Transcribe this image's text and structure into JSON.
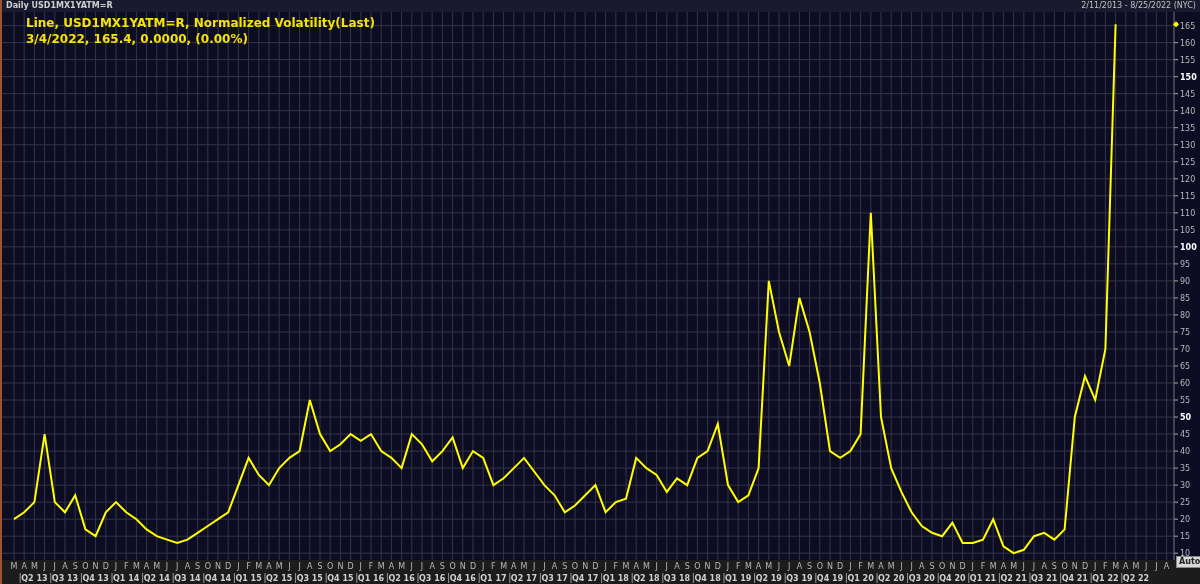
{
  "header": {
    "title": "Daily USD1MX1YATM=R",
    "date_range": "2/11/2013 - 8/25/2022 (NYC)"
  },
  "legend": {
    "chart_label": "Line,",
    "separator": ",",
    "field": "Normalized Volatility(Last)",
    "line_2": "3/4/2022, 165.4, 0.0000, (0.00%)"
  },
  "chart": {
    "chart_data": {
      "type": "line",
      "categories": [
        "M",
        "A",
        "M",
        "J",
        "J",
        "A",
        "S",
        "O",
        "N",
        "D",
        "J",
        "F",
        "M",
        "A",
        "M",
        "J",
        "J",
        "A",
        "S",
        "O",
        "N",
        "D",
        "J",
        "F",
        "M",
        "A",
        "M",
        "J",
        "J",
        "A",
        "S",
        "O",
        "N",
        "D",
        "J",
        "F",
        "M",
        "A",
        "M",
        "J",
        "J",
        "A",
        "S",
        "O",
        "N",
        "D",
        "J",
        "F",
        "M",
        "A",
        "M",
        "J",
        "J",
        "A",
        "S",
        "O",
        "N",
        "D",
        "J",
        "F",
        "M",
        "A",
        "M",
        "J",
        "J",
        "A",
        "S",
        "O",
        "N",
        "D",
        "J",
        "F",
        "M",
        "A",
        "M",
        "J",
        "J",
        "A",
        "S",
        "O",
        "N",
        "D",
        "J",
        "F",
        "M",
        "A",
        "M",
        "J",
        "J",
        "A",
        "S",
        "O",
        "N",
        "D",
        "J",
        "F",
        "M",
        "A",
        "M",
        "J",
        "J",
        "A",
        "S",
        "O",
        "N",
        "D",
        "J",
        "F",
        "M",
        "A",
        "M",
        "J",
        "J",
        "A"
      ],
      "series": [
        {
          "name": "USD1MX1YATM=R",
          "color": "#ffff00",
          "values": [
            20,
            22,
            25,
            45,
            25,
            22,
            27,
            17,
            15,
            22,
            25,
            22,
            20,
            17,
            15,
            14,
            13,
            14,
            16,
            18,
            20,
            22,
            30,
            38,
            33,
            30,
            35,
            38,
            40,
            55,
            45,
            40,
            42,
            45,
            43,
            45,
            40,
            38,
            35,
            45,
            42,
            37,
            40,
            44,
            35,
            40,
            38,
            30,
            32,
            35,
            38,
            34,
            30,
            27,
            22,
            24,
            27,
            30,
            22,
            25,
            26,
            38,
            35,
            33,
            28,
            32,
            30,
            38,
            40,
            48,
            30,
            25,
            27,
            35,
            90,
            75,
            65,
            85,
            75,
            60,
            40,
            38,
            40,
            45,
            110,
            50,
            35,
            28,
            22,
            18,
            16,
            15,
            19,
            13,
            13,
            14,
            20,
            12,
            10,
            11,
            15,
            16,
            14,
            17,
            50,
            62,
            55,
            70,
            165.4,
            null,
            null,
            null,
            null,
            null
          ]
        }
      ],
      "grid": true,
      "ylim": [
        8,
        169
      ],
      "yticks": [
        10,
        15,
        20,
        25,
        30,
        35,
        40,
        45,
        50,
        55,
        60,
        65,
        70,
        75,
        80,
        85,
        90,
        95,
        100,
        105,
        110,
        115,
        120,
        125,
        130,
        135,
        140,
        145,
        150,
        155,
        160,
        165
      ]
    },
    "quarter_labels": [
      "Q2 13",
      "Q3 13",
      "Q4 13",
      "Q1 14",
      "Q2 14",
      "Q3 14",
      "Q4 14",
      "Q1 15",
      "Q2 15",
      "Q3 15",
      "Q4 15",
      "Q1 16",
      "Q2 16",
      "Q3 16",
      "Q4 16",
      "Q1 17",
      "Q2 17",
      "Q3 17",
      "Q4 17",
      "Q1 18",
      "Q2 18",
      "Q3 18",
      "Q4 18",
      "Q1 19",
      "Q2 19",
      "Q3 19",
      "Q4 19",
      "Q1 20",
      "Q2 20",
      "Q3 20",
      "Q4 20",
      "Q1 21",
      "Q2 21",
      "Q3 21",
      "Q4 21",
      "Q1 22",
      "Q2 22"
    ],
    "scale_button": "Auto"
  }
}
